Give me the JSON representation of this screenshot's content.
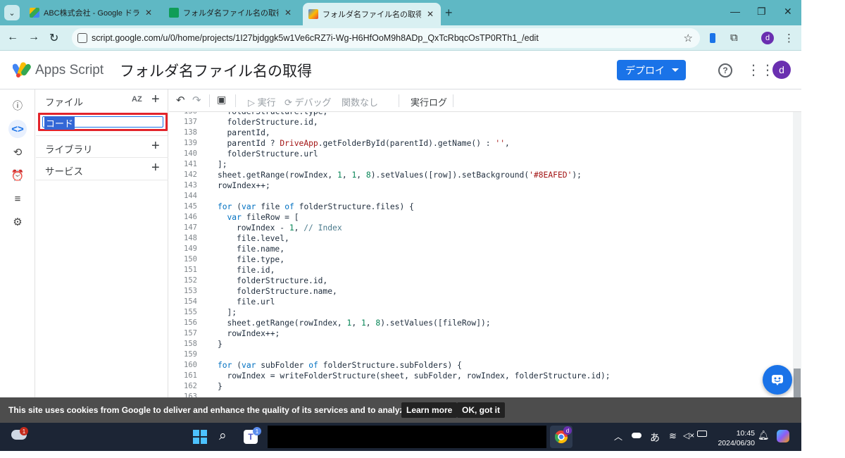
{
  "browser": {
    "tabs": [
      {
        "title": "ABC株式会社 - Google ドライブ",
        "favicon_color": "#34a853"
      },
      {
        "title": "フォルダ名ファイル名の取得 - Goo",
        "favicon_color": "#0f9d58"
      },
      {
        "title": "フォルダ名ファイル名の取得 - プロジ",
        "favicon_color": "#fbbc04"
      }
    ],
    "url": "script.google.com/u/0/home/projects/1I27bjdggk5w1Ve6cRZ7i-Wg-H6HfOoM9h8ADp_QxTcRbqcOsTP0RTh1_/edit",
    "profile_initial": "d"
  },
  "app": {
    "name": "Apps Script",
    "project": "フォルダ名ファイル名の取得",
    "deploy_label": "デプロイ",
    "avatar_initial": "d"
  },
  "files_panel": {
    "header": "ファイル",
    "sort_label": "AZ",
    "rename_value": "コード",
    "sections": [
      {
        "label": "ライブラリ"
      },
      {
        "label": "サービス"
      }
    ]
  },
  "toolbar": {
    "run": "実行",
    "debug": "デバッグ",
    "function": "関数なし",
    "log": "実行ログ"
  },
  "editor": {
    "lines": [
      {
        "n": "136",
        "indent": 1,
        "html": "folderStructure.type,"
      },
      {
        "n": "137",
        "indent": 1,
        "html": "folderStructure.id,"
      },
      {
        "n": "138",
        "indent": 1,
        "html": "parentId,"
      },
      {
        "n": "139",
        "indent": 1,
        "html": "parentId ? <span class='st'>DriveApp</span>.getFolderById(parentId).getName() : <span class='st'>''</span>,"
      },
      {
        "n": "140",
        "indent": 1,
        "html": "folderStructure.url"
      },
      {
        "n": "141",
        "indent": 0,
        "html": "];"
      },
      {
        "n": "142",
        "indent": 0,
        "html": "sheet.getRange(rowIndex, <span class='num'>1</span>, <span class='num'>1</span>, <span class='num'>8</span>).setValues([row]).setBackground(<span class='st'>'#8EAFED'</span>);"
      },
      {
        "n": "143",
        "indent": 0,
        "html": "rowIndex++;"
      },
      {
        "n": "144",
        "indent": 0,
        "html": ""
      },
      {
        "n": "145",
        "indent": 0,
        "html": "<span class='kw'>for</span> (<span class='kw'>var</span> file <span class='kw'>of</span> folderStructure.files) {"
      },
      {
        "n": "146",
        "indent": 1,
        "html": "<span class='kw'>var</span> fileRow = ["
      },
      {
        "n": "147",
        "indent": 2,
        "html": "rowIndex - <span class='num'>1</span>, <span class='cm'>// Index</span>"
      },
      {
        "n": "148",
        "indent": 2,
        "html": "file.level,"
      },
      {
        "n": "149",
        "indent": 2,
        "html": "file.name,"
      },
      {
        "n": "150",
        "indent": 2,
        "html": "file.type,"
      },
      {
        "n": "151",
        "indent": 2,
        "html": "file.id,"
      },
      {
        "n": "152",
        "indent": 2,
        "html": "folderStructure.id,"
      },
      {
        "n": "153",
        "indent": 2,
        "html": "folderStructure.name,"
      },
      {
        "n": "154",
        "indent": 2,
        "html": "file.url"
      },
      {
        "n": "155",
        "indent": 1,
        "html": "];"
      },
      {
        "n": "156",
        "indent": 1,
        "html": "sheet.getRange(rowIndex, <span class='num'>1</span>, <span class='num'>1</span>, <span class='num'>8</span>).setValues([fileRow]);"
      },
      {
        "n": "157",
        "indent": 1,
        "html": "rowIndex++;"
      },
      {
        "n": "158",
        "indent": 0,
        "html": "}"
      },
      {
        "n": "159",
        "indent": 0,
        "html": ""
      },
      {
        "n": "160",
        "indent": 0,
        "html": "<span class='kw'>for</span> (<span class='kw'>var</span> subFolder <span class='kw'>of</span> folderStructure.subFolders) {"
      },
      {
        "n": "161",
        "indent": 1,
        "html": "rowIndex = writeFolderStructure(sheet, subFolder, rowIndex, folderStructure.id);"
      },
      {
        "n": "162",
        "indent": 0,
        "html": "}"
      },
      {
        "n": "163",
        "indent": 0,
        "html": ""
      }
    ]
  },
  "cookie_bar": {
    "text": "This site uses cookies from Google to deliver and enhance the quality of its services and to analyze traffic.",
    "learn_more": "Learn more",
    "ok": "OK, got it"
  },
  "taskbar": {
    "time": "10:45",
    "date": "2024/06/30",
    "ime": "あ",
    "weather_badge": "1",
    "teams_badge": "1",
    "chrome_profile": "d"
  },
  "colors": {
    "tabstrip": "#5fb8c4",
    "accent": "#1a73e8",
    "highlight_box": "#e3242b"
  }
}
